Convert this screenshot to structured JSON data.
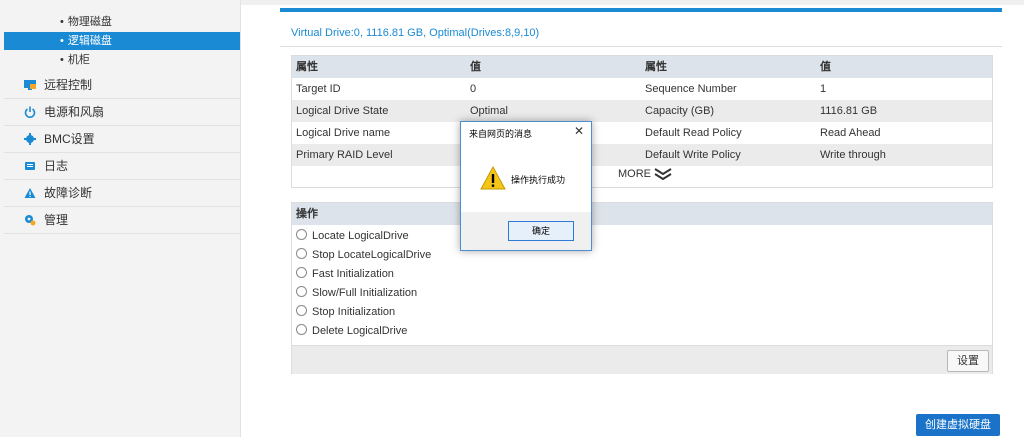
{
  "sidebar": {
    "sub_items": [
      {
        "label": "物理磁盘",
        "active": false
      },
      {
        "label": "逻辑磁盘",
        "active": true
      },
      {
        "label": "机柜",
        "active": false
      }
    ],
    "items": [
      {
        "label": "远程控制",
        "icon": "monitor-icon"
      },
      {
        "label": "电源和风扇",
        "icon": "power-icon"
      },
      {
        "label": "BMC设置",
        "icon": "gear-icon"
      },
      {
        "label": "日志",
        "icon": "log-icon"
      },
      {
        "label": "故障诊断",
        "icon": "warning-icon"
      },
      {
        "label": "管理",
        "icon": "settings-icon"
      }
    ]
  },
  "main": {
    "vd_title": "Virtual Drive:0, 1116.81 GB, Optimal(Drives:8,9,10)",
    "props_table": {
      "headers": [
        "属性",
        "值",
        "属性",
        "值"
      ],
      "rows": [
        [
          "Target ID",
          "0",
          "Sequence Number",
          "1"
        ],
        [
          "Logical Drive State",
          "Optimal",
          "Capacity (GB)",
          "1116.81 GB"
        ],
        [
          "Logical Drive name",
          "",
          "Default Read Policy",
          "Read Ahead"
        ],
        [
          "Primary RAID Level",
          "",
          "Default Write Policy",
          "Write through"
        ]
      ],
      "more_label": "MORE"
    },
    "operations": {
      "header": "操作",
      "options": [
        "Locate LogicalDrive",
        "Stop LocateLogicalDrive",
        "Fast Initialization",
        "Slow/Full Initialization",
        "Stop Initialization",
        "Delete LogicalDrive"
      ],
      "set_button": "设置"
    },
    "create_button": "创建虚拟硬盘"
  },
  "dialog": {
    "title": "来自网页的消息",
    "close": "✕",
    "message": "操作执行成功",
    "ok_button": "确定"
  },
  "colors": {
    "accent": "#1a8ad4",
    "button": "#1a73c8",
    "warning": "#f5c518"
  }
}
